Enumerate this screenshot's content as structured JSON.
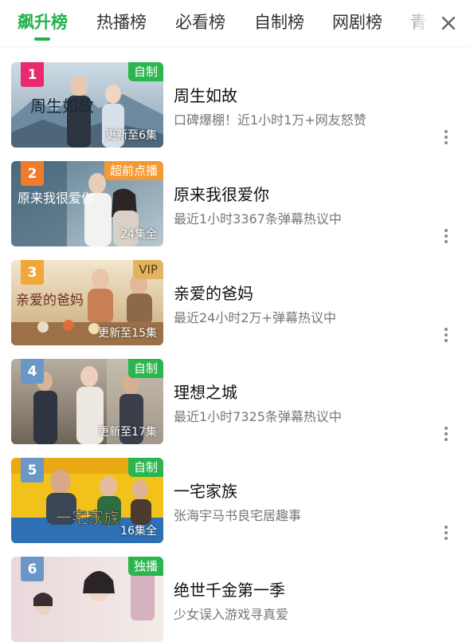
{
  "tabs": [
    {
      "label": "飙升榜",
      "active": true
    },
    {
      "label": "热播榜",
      "active": false
    },
    {
      "label": "必看榜",
      "active": false
    },
    {
      "label": "自制榜",
      "active": false
    },
    {
      "label": "网剧榜",
      "active": false
    },
    {
      "label": "青",
      "active": false
    }
  ],
  "close_icon": "close-icon",
  "colors": {
    "accent": "#22b24c",
    "badge_green": "#2ab54e",
    "badge_orange": "#f59a32",
    "badge_vip": "#e0b460",
    "rank_1": "#ea2a6e",
    "rank_2": "#f07b2a",
    "rank_3": "#f0a83a",
    "rank_other": "#6a96c8"
  },
  "items": [
    {
      "rank": "1",
      "badge": "自制",
      "poster_text": "周生如故",
      "status": "更新至6集",
      "title": "周生如故",
      "desc": "口碑爆棚！近1小时1万+网友怒赞"
    },
    {
      "rank": "2",
      "badge": "超前点播",
      "poster_text": "原来我很爱你",
      "status": "24集全",
      "title": "原来我很爱你",
      "desc": "最近1小时3367条弹幕热议中"
    },
    {
      "rank": "3",
      "badge": "VIP",
      "poster_text": "亲爱的爸妈",
      "status": "更新至15集",
      "title": "亲爱的爸妈",
      "desc": "最近24小时2万+弹幕热议中"
    },
    {
      "rank": "4",
      "badge": "自制",
      "poster_text": "",
      "status": "更新至17集",
      "title": "理想之城",
      "desc": "最近1小时7325条弹幕热议中"
    },
    {
      "rank": "5",
      "badge": "自制",
      "poster_text": "一宅家族",
      "status": "16集全",
      "title": "一宅家族",
      "desc": "张海宇马书良宅居趣事"
    },
    {
      "rank": "6",
      "badge": "独播",
      "poster_text": "",
      "status": "",
      "title": "绝世千金第一季",
      "desc": "少女误入游戏寻真爱"
    }
  ]
}
